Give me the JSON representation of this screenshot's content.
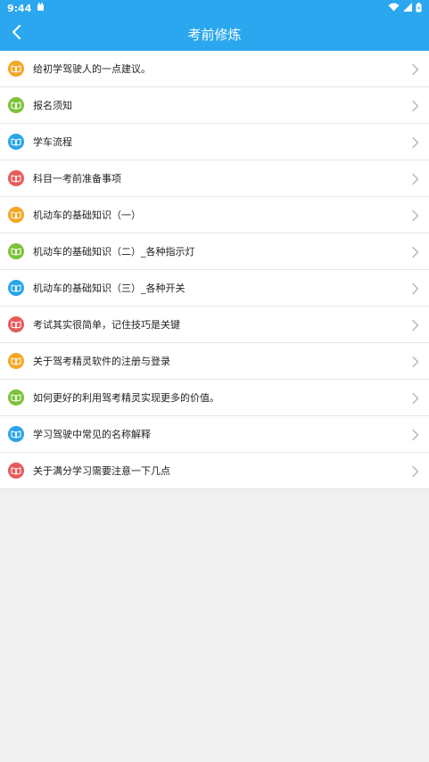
{
  "status": {
    "time": "9:44"
  },
  "appbar": {
    "title": "考前修炼"
  },
  "colors": {
    "orange": "#f5a623",
    "green": "#7cc23b",
    "blue": "#29a5e8",
    "red": "#e85a5a",
    "primary": "#2aa7ee"
  },
  "items": [
    {
      "label": "给初学驾驶人的一点建议。",
      "color": "#f5a623"
    },
    {
      "label": "报名须知",
      "color": "#7cc23b"
    },
    {
      "label": "学车流程",
      "color": "#29a5e8"
    },
    {
      "label": "科目一考前准备事项",
      "color": "#e85a5a"
    },
    {
      "label": "机动车的基础知识（一）",
      "color": "#f5a623"
    },
    {
      "label": "机动车的基础知识（二）_各种指示灯",
      "color": "#7cc23b"
    },
    {
      "label": "机动车的基础知识（三）_各种开关",
      "color": "#29a5e8"
    },
    {
      "label": "考试其实很简单，记住技巧是关键",
      "color": "#e85a5a"
    },
    {
      "label": "关于驾考精灵软件的注册与登录",
      "color": "#f5a623"
    },
    {
      "label": "如何更好的利用驾考精灵实现更多的价值。",
      "color": "#7cc23b"
    },
    {
      "label": "学习驾驶中常见的名称解释",
      "color": "#29a5e8"
    },
    {
      "label": "关于满分学习需要注意一下几点",
      "color": "#e85a5a"
    }
  ]
}
